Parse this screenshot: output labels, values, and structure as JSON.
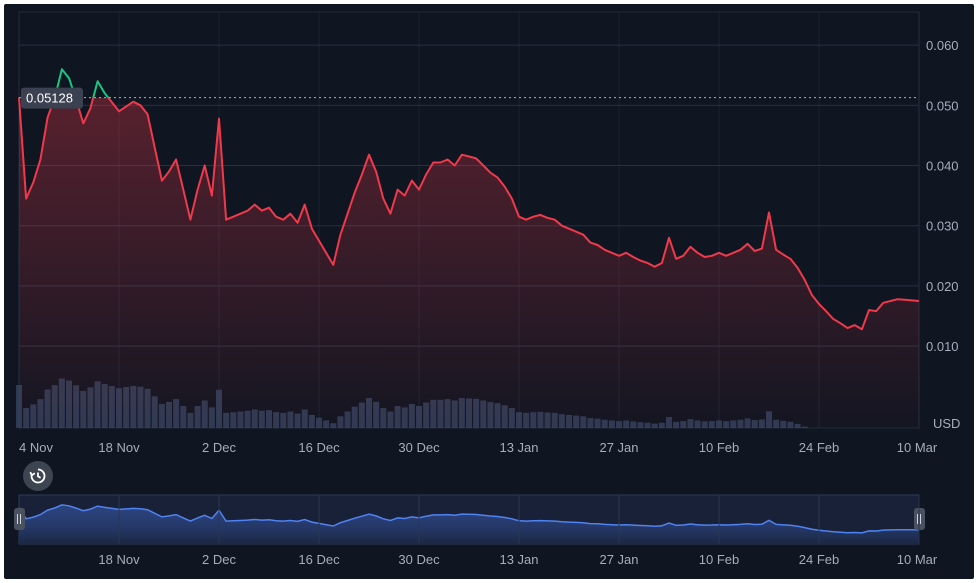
{
  "chart_data": {
    "type": "area",
    "ylabel": "USD",
    "ylim": [
      0,
      0.065
    ],
    "yticks": [
      0.01,
      0.02,
      0.03,
      0.04,
      0.05,
      0.06
    ],
    "ytick_labels": [
      "0.010",
      "0.020",
      "0.030",
      "0.040",
      "0.050",
      "0.060"
    ],
    "xticks": [
      "4 Nov",
      "18 Nov",
      "2 Dec",
      "16 Dec",
      "30 Dec",
      "13 Jan",
      "27 Jan",
      "10 Feb",
      "24 Feb",
      "10 Mar"
    ],
    "navigator_xticks": [
      "18 Nov",
      "2 Dec",
      "16 Dec",
      "30 Dec",
      "13 Jan",
      "27 Jan",
      "10 Feb",
      "24 Feb",
      "10 Mar"
    ],
    "reference_line": {
      "label": "0.05128",
      "value": 0.05128
    },
    "colors": {
      "below_reference": "#f0394a",
      "above_reference": "#16c784",
      "navigator": "#4f83f2",
      "volume": "#3a4a6a"
    },
    "grid": true,
    "series": [
      {
        "values": [
          {
            "date": "4 Nov",
            "price": 0.05128
          },
          {
            "date": "5 Nov",
            "price": 0.0345
          },
          {
            "date": "6 Nov",
            "price": 0.0372
          },
          {
            "date": "7 Nov",
            "price": 0.041
          },
          {
            "date": "8 Nov",
            "price": 0.048
          },
          {
            "date": "9 Nov",
            "price": 0.0512
          },
          {
            "date": "10 Nov",
            "price": 0.056
          },
          {
            "date": "11 Nov",
            "price": 0.0545
          },
          {
            "date": "12 Nov",
            "price": 0.051
          },
          {
            "date": "13 Nov",
            "price": 0.047
          },
          {
            "date": "14 Nov",
            "price": 0.0495
          },
          {
            "date": "15 Nov",
            "price": 0.054
          },
          {
            "date": "16 Nov",
            "price": 0.052
          },
          {
            "date": "17 Nov",
            "price": 0.0505
          },
          {
            "date": "18 Nov",
            "price": 0.049
          },
          {
            "date": "19 Nov",
            "price": 0.0498
          },
          {
            "date": "20 Nov",
            "price": 0.0506
          },
          {
            "date": "21 Nov",
            "price": 0.05
          },
          {
            "date": "22 Nov",
            "price": 0.0485
          },
          {
            "date": "23 Nov",
            "price": 0.043
          },
          {
            "date": "24 Nov",
            "price": 0.0375
          },
          {
            "date": "25 Nov",
            "price": 0.039
          },
          {
            "date": "26 Nov",
            "price": 0.041
          },
          {
            "date": "27 Nov",
            "price": 0.036
          },
          {
            "date": "28 Nov",
            "price": 0.031
          },
          {
            "date": "29 Nov",
            "price": 0.036
          },
          {
            "date": "30 Nov",
            "price": 0.04
          },
          {
            "date": "1 Dec",
            "price": 0.035
          },
          {
            "date": "2 Dec",
            "price": 0.0478
          },
          {
            "date": "3 Dec",
            "price": 0.031
          },
          {
            "date": "4 Dec",
            "price": 0.0315
          },
          {
            "date": "5 Dec",
            "price": 0.032
          },
          {
            "date": "6 Dec",
            "price": 0.0325
          },
          {
            "date": "7 Dec",
            "price": 0.0335
          },
          {
            "date": "8 Dec",
            "price": 0.0325
          },
          {
            "date": "9 Dec",
            "price": 0.033
          },
          {
            "date": "10 Dec",
            "price": 0.0315
          },
          {
            "date": "11 Dec",
            "price": 0.031
          },
          {
            "date": "12 Dec",
            "price": 0.032
          },
          {
            "date": "13 Dec",
            "price": 0.0305
          },
          {
            "date": "14 Dec",
            "price": 0.0335
          },
          {
            "date": "15 Dec",
            "price": 0.0295
          },
          {
            "date": "16 Dec",
            "price": 0.0275
          },
          {
            "date": "17 Dec",
            "price": 0.0255
          },
          {
            "date": "18 Dec",
            "price": 0.0235
          },
          {
            "date": "19 Dec",
            "price": 0.0285
          },
          {
            "date": "20 Dec",
            "price": 0.032
          },
          {
            "date": "21 Dec",
            "price": 0.0355
          },
          {
            "date": "22 Dec",
            "price": 0.0385
          },
          {
            "date": "23 Dec",
            "price": 0.0418
          },
          {
            "date": "24 Dec",
            "price": 0.039
          },
          {
            "date": "25 Dec",
            "price": 0.0345
          },
          {
            "date": "26 Dec",
            "price": 0.032
          },
          {
            "date": "27 Dec",
            "price": 0.036
          },
          {
            "date": "28 Dec",
            "price": 0.035
          },
          {
            "date": "29 Dec",
            "price": 0.0375
          },
          {
            "date": "30 Dec",
            "price": 0.036
          },
          {
            "date": "31 Dec",
            "price": 0.0385
          },
          {
            "date": "1 Jan",
            "price": 0.0405
          },
          {
            "date": "2 Jan",
            "price": 0.0405
          },
          {
            "date": "3 Jan",
            "price": 0.041
          },
          {
            "date": "4 Jan",
            "price": 0.04
          },
          {
            "date": "5 Jan",
            "price": 0.0418
          },
          {
            "date": "6 Jan",
            "price": 0.0415
          },
          {
            "date": "7 Jan",
            "price": 0.0412
          },
          {
            "date": "8 Jan",
            "price": 0.04
          },
          {
            "date": "9 Jan",
            "price": 0.0388
          },
          {
            "date": "10 Jan",
            "price": 0.038
          },
          {
            "date": "11 Jan",
            "price": 0.0365
          },
          {
            "date": "12 Jan",
            "price": 0.0345
          },
          {
            "date": "13 Jan",
            "price": 0.0315
          },
          {
            "date": "14 Jan",
            "price": 0.031
          },
          {
            "date": "15 Jan",
            "price": 0.0315
          },
          {
            "date": "16 Jan",
            "price": 0.0318
          },
          {
            "date": "17 Jan",
            "price": 0.0313
          },
          {
            "date": "18 Jan",
            "price": 0.031
          },
          {
            "date": "19 Jan",
            "price": 0.03
          },
          {
            "date": "20 Jan",
            "price": 0.0295
          },
          {
            "date": "21 Jan",
            "price": 0.029
          },
          {
            "date": "22 Jan",
            "price": 0.0285
          },
          {
            "date": "23 Jan",
            "price": 0.0272
          },
          {
            "date": "24 Jan",
            "price": 0.0268
          },
          {
            "date": "25 Jan",
            "price": 0.026
          },
          {
            "date": "26 Jan",
            "price": 0.0255
          },
          {
            "date": "27 Jan",
            "price": 0.025
          },
          {
            "date": "28 Jan",
            "price": 0.0255
          },
          {
            "date": "29 Jan",
            "price": 0.0248
          },
          {
            "date": "30 Jan",
            "price": 0.0242
          },
          {
            "date": "31 Jan",
            "price": 0.0238
          },
          {
            "date": "1 Feb",
            "price": 0.0232
          },
          {
            "date": "2 Feb",
            "price": 0.0238
          },
          {
            "date": "3 Feb",
            "price": 0.028
          },
          {
            "date": "4 Feb",
            "price": 0.0245
          },
          {
            "date": "5 Feb",
            "price": 0.025
          },
          {
            "date": "6 Feb",
            "price": 0.0265
          },
          {
            "date": "7 Feb",
            "price": 0.0255
          },
          {
            "date": "8 Feb",
            "price": 0.0248
          },
          {
            "date": "9 Feb",
            "price": 0.025
          },
          {
            "date": "10 Feb",
            "price": 0.0255
          },
          {
            "date": "11 Feb",
            "price": 0.025
          },
          {
            "date": "12 Feb",
            "price": 0.0255
          },
          {
            "date": "13 Feb",
            "price": 0.026
          },
          {
            "date": "14 Feb",
            "price": 0.027
          },
          {
            "date": "15 Feb",
            "price": 0.0258
          },
          {
            "date": "16 Feb",
            "price": 0.0262
          },
          {
            "date": "17 Feb",
            "price": 0.0322
          },
          {
            "date": "18 Feb",
            "price": 0.026
          },
          {
            "date": "19 Feb",
            "price": 0.0252
          },
          {
            "date": "20 Feb",
            "price": 0.0245
          },
          {
            "date": "21 Feb",
            "price": 0.023
          },
          {
            "date": "22 Feb",
            "price": 0.021
          },
          {
            "date": "23 Feb",
            "price": 0.0185
          },
          {
            "date": "24 Feb",
            "price": 0.017
          },
          {
            "date": "25 Feb",
            "price": 0.0158
          },
          {
            "date": "26 Feb",
            "price": 0.0145
          },
          {
            "date": "27 Feb",
            "price": 0.0138
          },
          {
            "date": "28 Feb",
            "price": 0.013
          },
          {
            "date": "1 Mar",
            "price": 0.0135
          },
          {
            "date": "2 Mar",
            "price": 0.0128
          },
          {
            "date": "3 Mar",
            "price": 0.016
          },
          {
            "date": "4 Mar",
            "price": 0.0158
          },
          {
            "date": "5 Mar",
            "price": 0.0172
          },
          {
            "date": "6 Mar",
            "price": 0.0175
          },
          {
            "date": "7 Mar",
            "price": 0.0178
          },
          {
            "date": "8 Mar",
            "price": 0.0177
          },
          {
            "date": "9 Mar",
            "price": 0.0176
          },
          {
            "date": "10 Mar",
            "price": 0.0175
          }
        ]
      }
    ]
  }
}
